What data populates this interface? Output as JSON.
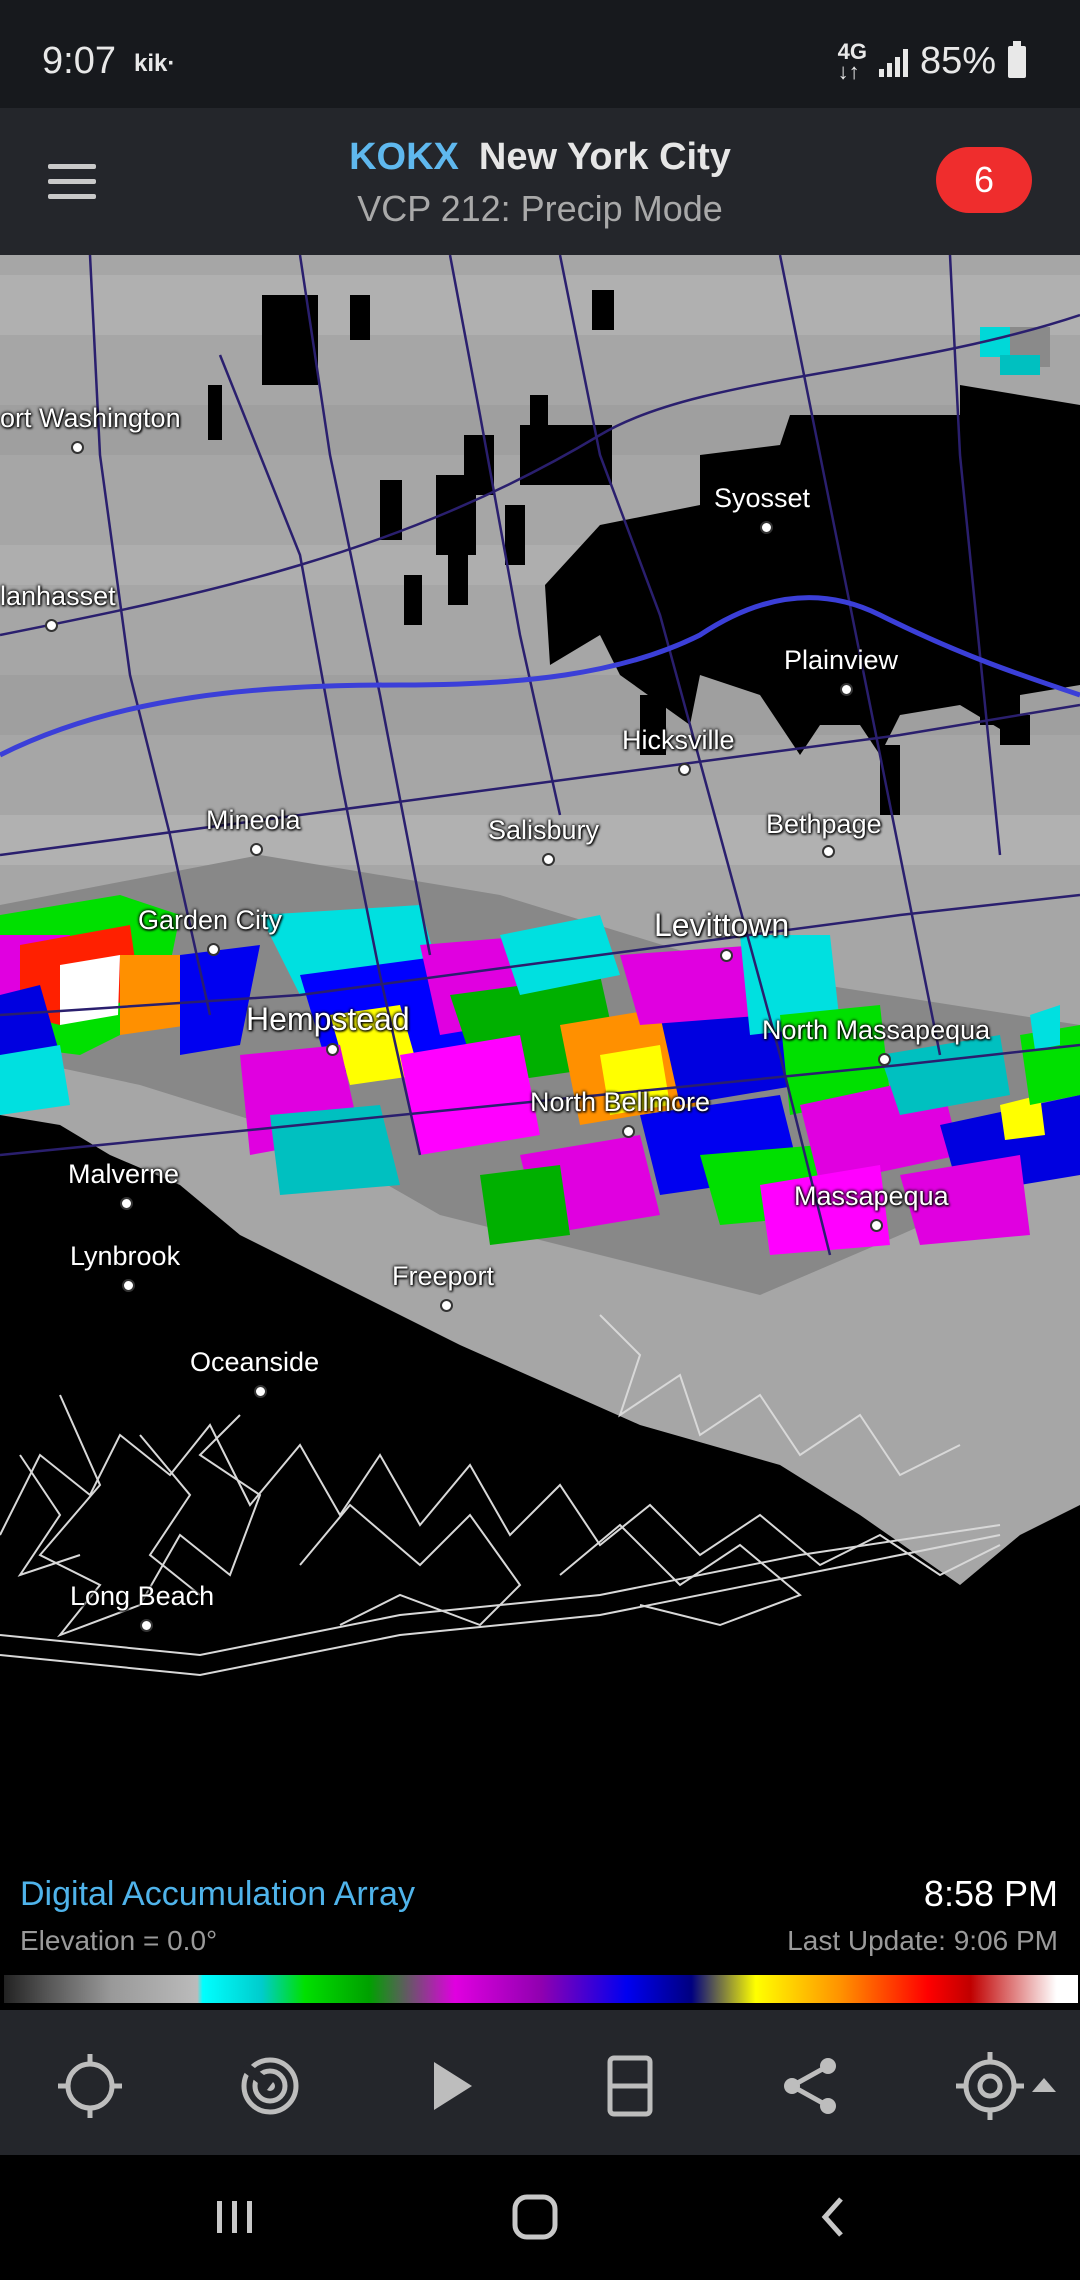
{
  "status": {
    "time": "9:07",
    "app_icon": "kik·",
    "network": "4G LTE",
    "battery": "85%"
  },
  "header": {
    "station": "KOKX",
    "city": "New York City",
    "subtitle": "VCP 212: Precip Mode",
    "badge": "6"
  },
  "map": {
    "places": [
      {
        "name": "ort Washington"
      },
      {
        "name": "Syosset"
      },
      {
        "name": "lanhasset"
      },
      {
        "name": "Plainview"
      },
      {
        "name": "Hicksville"
      },
      {
        "name": "Mineola"
      },
      {
        "name": "Salisbury"
      },
      {
        "name": "Bethpage"
      },
      {
        "name": "Garden City"
      },
      {
        "name": "Levittown"
      },
      {
        "name": "Hempstead"
      },
      {
        "name": "North Massapequa"
      },
      {
        "name": "North Bellmore"
      },
      {
        "name": "Malverne"
      },
      {
        "name": "Massapequa"
      },
      {
        "name": "Lynbrook"
      },
      {
        "name": "Freeport"
      },
      {
        "name": "Oceanside"
      },
      {
        "name": "Long Beach"
      }
    ]
  },
  "info": {
    "product": "Digital Accumulation Array",
    "elevation": "Elevation = 0.0°",
    "time": "8:58 PM",
    "last_update": "Last Update: 9:06 PM"
  },
  "toolbar": {
    "icons": [
      "locate-icon",
      "radar-icon",
      "play-icon",
      "layout-icon",
      "share-icon",
      "target-icon"
    ]
  },
  "nav": {
    "icons": [
      "recents-icon",
      "home-icon",
      "back-icon"
    ]
  }
}
